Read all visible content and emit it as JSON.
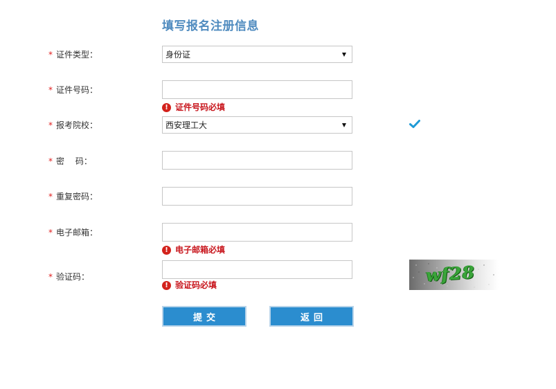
{
  "form": {
    "title": "填写报名注册信息",
    "required_mark": "*",
    "fields": {
      "id_type": {
        "label": "证件类型：",
        "value": "身份证"
      },
      "id_number": {
        "label": "证件号码：",
        "value": "",
        "error": "证件号码必填"
      },
      "school": {
        "label": "报考院校：",
        "value": "西安理工大",
        "status": "valid"
      },
      "password": {
        "label": "密　 码：",
        "value": ""
      },
      "confirm_password": {
        "label": "重复密码：",
        "value": ""
      },
      "email": {
        "label": "电子邮箱：",
        "value": "",
        "error": "电子邮箱必填"
      },
      "captcha": {
        "label": "验证码：",
        "value": "",
        "error": "验证码必填",
        "image_text": "wf28"
      }
    },
    "buttons": {
      "submit": "提交",
      "back": "返回"
    }
  },
  "icons": {
    "error": "exclamation-circle-icon",
    "valid": "checkmark-icon",
    "select_arrow": "triangle-down-icon"
  },
  "colors": {
    "title": "#4f8bbf",
    "required": "#e02020",
    "error": "#c8161d",
    "button": "#2b8dcf",
    "check": "#1e9ad6"
  }
}
